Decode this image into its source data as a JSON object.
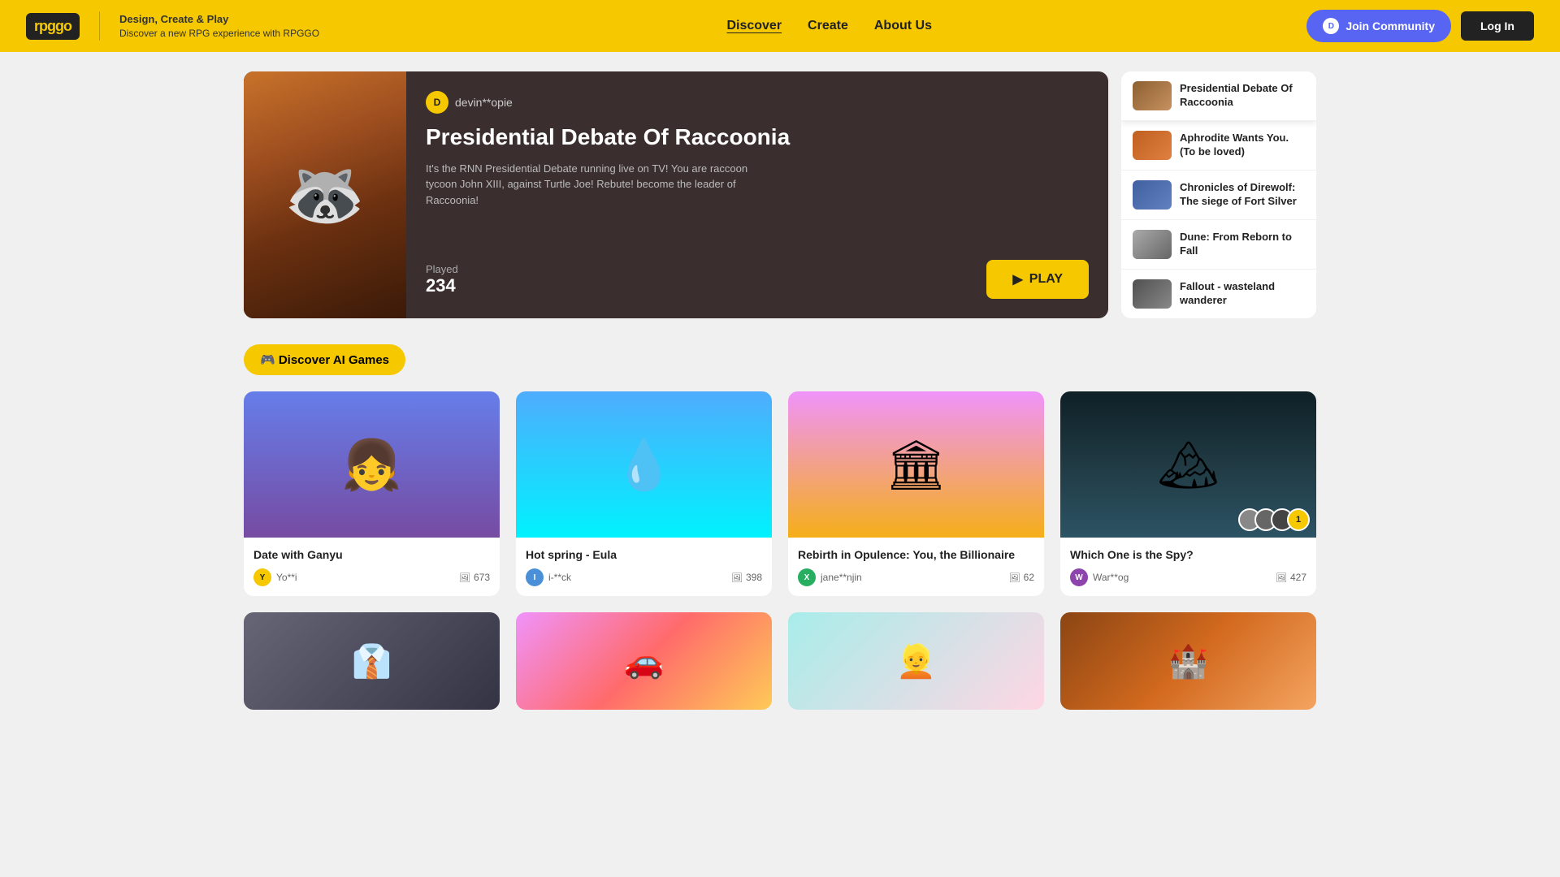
{
  "header": {
    "logo_text": "rpggo",
    "tagline_line1": "Design, Create & Play",
    "tagline_line2": "Discover a new RPG experience with RPGGO",
    "nav": [
      {
        "label": "Discover",
        "active": true
      },
      {
        "label": "Create",
        "active": false
      },
      {
        "label": "About Us",
        "active": false
      }
    ],
    "join_community_label": "Join Community",
    "login_label": "Log In"
  },
  "hero": {
    "author": "devin**opie",
    "title": "Presidential Debate Of Raccoonia",
    "description": "It's the RNN Presidential Debate running live on TV! You are raccoon tycoon John XIII, against Turtle Joe! Rebute! become the leader of Raccoonia!",
    "played_label": "Played",
    "played_count": "234",
    "play_button": "PLAY"
  },
  "sidebar_games": [
    {
      "title": "Presidential Debate Of Raccoonia",
      "thumb_class": "sidebar-thumb-1",
      "emoji": ""
    },
    {
      "title": "Aphrodite Wants You. (To be loved)",
      "thumb_class": "sidebar-thumb-2",
      "emoji": ""
    },
    {
      "title": "Chronicles of Direwolf: The siege of Fort Silver",
      "thumb_class": "sidebar-thumb-3",
      "emoji": ""
    },
    {
      "title": "Dune: From Reborn to Fall",
      "thumb_class": "sidebar-thumb-4",
      "emoji": ""
    },
    {
      "title": "Fallout - wasteland wanderer",
      "thumb_class": "sidebar-thumb-5",
      "emoji": ""
    }
  ],
  "discover_section": {
    "label": "🎮 Discover AI Games"
  },
  "game_cards": [
    {
      "title": "Date with Ganyu",
      "author": "Yo**i",
      "avatar_class": "avatar-yellow",
      "avatar_letter": "Y",
      "views": "673",
      "img_class": "game-card-img-1",
      "has_players": false
    },
    {
      "title": "Hot spring - Eula",
      "author": "i-**ck",
      "avatar_class": "avatar-blue",
      "avatar_letter": "I",
      "views": "398",
      "img_class": "game-card-img-2",
      "has_players": false
    },
    {
      "title": "Rebirth in Opulence: You, the Billionaire",
      "author": "jane**njin",
      "avatar_class": "avatar-green",
      "avatar_letter": "X",
      "views": "62",
      "img_class": "game-card-img-3",
      "has_players": false
    },
    {
      "title": "Which One is the Spy?",
      "author": "War**og",
      "avatar_class": "avatar-purple",
      "avatar_letter": "W",
      "views": "427",
      "img_class": "game-card-img-4",
      "has_players": true,
      "player_count": "1"
    }
  ],
  "bottom_cards": [
    {
      "img_class": "game-card-img-p1"
    },
    {
      "img_class": "game-card-img-p2"
    },
    {
      "img_class": "game-card-img-p3"
    },
    {
      "img_class": "game-card-img-p4"
    }
  ]
}
